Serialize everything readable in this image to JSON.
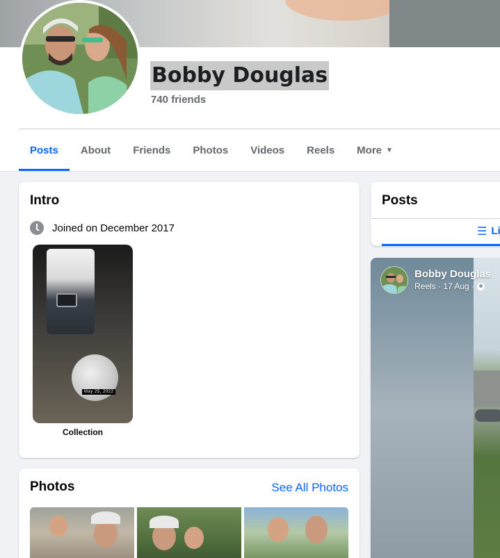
{
  "profile": {
    "name": "Bobby Douglas",
    "friends": "740 friends"
  },
  "tabs": [
    {
      "label": "Posts",
      "active": true
    },
    {
      "label": "About"
    },
    {
      "label": "Friends"
    },
    {
      "label": "Photos"
    },
    {
      "label": "Videos"
    },
    {
      "label": "Reels"
    },
    {
      "label": "More"
    }
  ],
  "intro": {
    "title": "Intro",
    "joined": "Joined on December 2017",
    "collection": {
      "label": "Collection",
      "date_stamp": "May 25, 2022"
    }
  },
  "photos": {
    "title": "Photos",
    "see_all": "See All Photos"
  },
  "posts": {
    "title": "Posts",
    "list_label": "List",
    "reel": {
      "author": "Bobby Douglas",
      "meta": "Reels · 17 Aug ·"
    }
  },
  "colors": {
    "accent": "#0866ff",
    "secondary_text": "#65676b",
    "background": "#f0f2f5"
  }
}
